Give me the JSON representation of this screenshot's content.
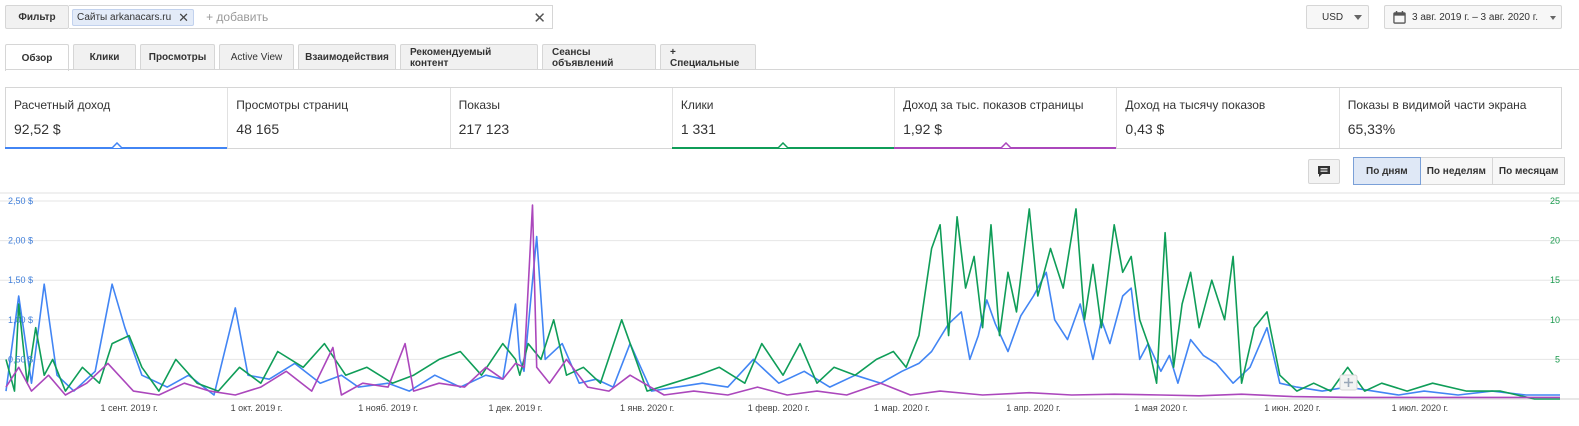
{
  "filter": {
    "label": "Фильтр",
    "chip_label": "Сайты",
    "chip_value": "arkanacars.ru",
    "add_placeholder": "+ добавить"
  },
  "currency": "USD",
  "date_range": "3 авг. 2019 г. – 3 авг. 2020 г.",
  "tabs": [
    {
      "label": "Обзор",
      "active": true
    },
    {
      "label": "Клики"
    },
    {
      "label": "Просмотры"
    },
    {
      "label": "Active View"
    },
    {
      "label": "Взаимодействия"
    },
    {
      "label": "Рекомендуемый контент"
    },
    {
      "label": "Сеансы объявлений"
    },
    {
      "label": "+ Специальные"
    }
  ],
  "scorecards": [
    {
      "label": "Расчетный доход",
      "value": "92,52 $",
      "color": "#4285f4"
    },
    {
      "label": "Просмотры страниц",
      "value": "48 165"
    },
    {
      "label": "Показы",
      "value": "217 123"
    },
    {
      "label": "Клики",
      "value": "1 331",
      "color": "#0f9d58"
    },
    {
      "label": "Доход за тыс. показов страницы",
      "value": "1,92 $",
      "color": "#ab47bc"
    },
    {
      "label": "Доход на тысячу показов",
      "value": "0,43 $"
    },
    {
      "label": "Показы в видимой части экрана",
      "value": "65,33%"
    }
  ],
  "granularity": [
    {
      "label": "По дням",
      "active": true
    },
    {
      "label": "По неделям"
    },
    {
      "label": "По месяцам"
    }
  ],
  "chart_data": {
    "type": "line",
    "grid": true,
    "y_left": {
      "ticks": [
        "0,50 $",
        "1,00 $",
        "1,50 $",
        "2,00 $",
        "2,50 $"
      ],
      "tick_values": [
        0.5,
        1.0,
        1.5,
        2.0,
        2.5
      ],
      "range": [
        0,
        2.5
      ]
    },
    "y_right": {
      "ticks": [
        "5",
        "10",
        "15",
        "20",
        "25"
      ],
      "tick_values": [
        5,
        10,
        15,
        20,
        25
      ],
      "range": [
        0,
        25
      ]
    },
    "x_ticks": [
      {
        "label": "1 сент. 2019 г.",
        "date": "2019-09-01"
      },
      {
        "label": "1 окт. 2019 г.",
        "date": "2019-10-01"
      },
      {
        "label": "1 нояб. 2019 г.",
        "date": "2019-11-01"
      },
      {
        "label": "1 дек. 2019 г.",
        "date": "2019-12-01"
      },
      {
        "label": "1 янв. 2020 г.",
        "date": "2020-01-01"
      },
      {
        "label": "1 февр. 2020 г.",
        "date": "2020-02-01"
      },
      {
        "label": "1 мар. 2020 г.",
        "date": "2020-03-01"
      },
      {
        "label": "1 апр. 2020 г.",
        "date": "2020-04-01"
      },
      {
        "label": "1 мая 2020 г.",
        "date": "2020-05-01"
      },
      {
        "label": "1 июн. 2020 г.",
        "date": "2020-06-01"
      },
      {
        "label": "1 июл. 2020 г.",
        "date": "2020-07-01"
      }
    ],
    "x_range": [
      "2019-08-03",
      "2020-08-03"
    ],
    "series": [
      {
        "color": "#4285f4",
        "axis": "left",
        "points": [
          [
            "2019-08-03",
            0.1
          ],
          [
            "2019-08-06",
            1.3
          ],
          [
            "2019-08-09",
            0.2
          ],
          [
            "2019-08-12",
            1.45
          ],
          [
            "2019-08-15",
            0.3
          ],
          [
            "2019-08-19",
            0.1
          ],
          [
            "2019-08-24",
            0.35
          ],
          [
            "2019-08-28",
            1.45
          ],
          [
            "2019-08-31",
            0.9
          ],
          [
            "2019-09-04",
            0.3
          ],
          [
            "2019-09-10",
            0.15
          ],
          [
            "2019-09-15",
            0.3
          ],
          [
            "2019-09-21",
            0.05
          ],
          [
            "2019-09-26",
            1.15
          ],
          [
            "2019-09-29",
            0.3
          ],
          [
            "2019-10-04",
            0.25
          ],
          [
            "2019-10-10",
            0.45
          ],
          [
            "2019-10-16",
            0.2
          ],
          [
            "2019-10-21",
            0.3
          ],
          [
            "2019-10-25",
            0.15
          ],
          [
            "2019-11-01",
            0.2
          ],
          [
            "2019-11-06",
            0.1
          ],
          [
            "2019-11-12",
            0.3
          ],
          [
            "2019-11-18",
            0.15
          ],
          [
            "2019-11-24",
            0.3
          ],
          [
            "2019-11-28",
            0.25
          ],
          [
            "2019-12-01",
            1.2
          ],
          [
            "2019-12-02",
            0.5
          ],
          [
            "2019-12-03",
            0.35
          ],
          [
            "2019-12-06",
            2.05
          ],
          [
            "2019-12-08",
            0.5
          ],
          [
            "2019-12-12",
            0.7
          ],
          [
            "2019-12-16",
            0.2
          ],
          [
            "2019-12-20",
            0.25
          ],
          [
            "2019-12-24",
            0.15
          ],
          [
            "2019-12-28",
            0.7
          ],
          [
            "2020-01-02",
            0.1
          ],
          [
            "2020-01-08",
            0.15
          ],
          [
            "2020-01-14",
            0.2
          ],
          [
            "2020-01-20",
            0.15
          ],
          [
            "2020-01-26",
            0.5
          ],
          [
            "2020-02-01",
            0.2
          ],
          [
            "2020-02-07",
            0.35
          ],
          [
            "2020-02-13",
            0.15
          ],
          [
            "2020-02-19",
            0.3
          ],
          [
            "2020-02-25",
            0.2
          ],
          [
            "2020-03-01",
            0.35
          ],
          [
            "2020-03-05",
            0.45
          ],
          [
            "2020-03-08",
            0.6
          ],
          [
            "2020-03-12",
            0.95
          ],
          [
            "2020-03-15",
            1.1
          ],
          [
            "2020-03-17",
            0.5
          ],
          [
            "2020-03-19",
            0.8
          ],
          [
            "2020-03-21",
            1.25
          ],
          [
            "2020-03-23",
            0.95
          ],
          [
            "2020-03-26",
            0.6
          ],
          [
            "2020-03-29",
            1.05
          ],
          [
            "2020-04-01",
            1.3
          ],
          [
            "2020-04-04",
            1.6
          ],
          [
            "2020-04-06",
            1.0
          ],
          [
            "2020-04-09",
            0.75
          ],
          [
            "2020-04-12",
            1.2
          ],
          [
            "2020-04-15",
            0.5
          ],
          [
            "2020-04-17",
            1.0
          ],
          [
            "2020-04-19",
            0.7
          ],
          [
            "2020-04-22",
            1.3
          ],
          [
            "2020-04-24",
            1.4
          ],
          [
            "2020-04-26",
            0.5
          ],
          [
            "2020-04-28",
            0.7
          ],
          [
            "2020-05-01",
            0.35
          ],
          [
            "2020-05-03",
            0.55
          ],
          [
            "2020-05-05",
            0.2
          ],
          [
            "2020-05-08",
            0.75
          ],
          [
            "2020-05-11",
            0.55
          ],
          [
            "2020-05-14",
            0.45
          ],
          [
            "2020-05-18",
            0.2
          ],
          [
            "2020-05-22",
            0.4
          ],
          [
            "2020-05-26",
            0.9
          ],
          [
            "2020-05-29",
            0.2
          ],
          [
            "2020-06-02",
            0.15
          ],
          [
            "2020-06-08",
            0.1
          ],
          [
            "2020-06-14",
            0.15
          ],
          [
            "2020-06-20",
            0.1
          ],
          [
            "2020-06-26",
            0.05
          ],
          [
            "2020-07-02",
            0.1
          ],
          [
            "2020-07-10",
            0.05
          ],
          [
            "2020-07-18",
            0.1
          ],
          [
            "2020-07-26",
            0.05
          ],
          [
            "2020-08-03",
            0.05
          ]
        ]
      },
      {
        "color": "#0f9d58",
        "axis": "right",
        "points": [
          [
            "2019-08-03",
            5
          ],
          [
            "2019-08-05",
            1
          ],
          [
            "2019-08-06",
            12
          ],
          [
            "2019-08-08",
            2
          ],
          [
            "2019-08-10",
            9
          ],
          [
            "2019-08-12",
            3
          ],
          [
            "2019-08-14",
            5
          ],
          [
            "2019-08-17",
            1
          ],
          [
            "2019-08-21",
            4
          ],
          [
            "2019-08-25",
            2
          ],
          [
            "2019-08-28",
            7
          ],
          [
            "2019-09-01",
            8
          ],
          [
            "2019-09-04",
            4
          ],
          [
            "2019-09-08",
            1
          ],
          [
            "2019-09-12",
            5
          ],
          [
            "2019-09-17",
            2
          ],
          [
            "2019-09-22",
            1
          ],
          [
            "2019-09-27",
            4
          ],
          [
            "2019-10-02",
            2
          ],
          [
            "2019-10-06",
            6
          ],
          [
            "2019-10-12",
            4
          ],
          [
            "2019-10-17",
            7
          ],
          [
            "2019-10-22",
            3
          ],
          [
            "2019-10-27",
            4
          ],
          [
            "2019-11-02",
            2
          ],
          [
            "2019-11-07",
            3
          ],
          [
            "2019-11-13",
            5
          ],
          [
            "2019-11-18",
            6
          ],
          [
            "2019-11-23",
            3
          ],
          [
            "2019-11-28",
            7
          ],
          [
            "2019-12-01",
            5
          ],
          [
            "2019-12-02",
            3
          ],
          [
            "2019-12-04",
            7
          ],
          [
            "2019-12-07",
            5
          ],
          [
            "2019-12-10",
            10
          ],
          [
            "2019-12-13",
            3
          ],
          [
            "2019-12-17",
            4
          ],
          [
            "2019-12-21",
            2
          ],
          [
            "2019-12-26",
            10
          ],
          [
            "2020-01-01",
            1
          ],
          [
            "2020-01-07",
            2
          ],
          [
            "2020-01-13",
            3
          ],
          [
            "2020-01-18",
            4
          ],
          [
            "2020-01-24",
            2
          ],
          [
            "2020-01-28",
            7
          ],
          [
            "2020-02-02",
            3
          ],
          [
            "2020-02-06",
            7
          ],
          [
            "2020-02-10",
            2
          ],
          [
            "2020-02-14",
            4
          ],
          [
            "2020-02-19",
            3
          ],
          [
            "2020-02-24",
            5
          ],
          [
            "2020-02-28",
            6
          ],
          [
            "2020-03-02",
            4
          ],
          [
            "2020-03-05",
            8
          ],
          [
            "2020-03-08",
            19
          ],
          [
            "2020-03-10",
            22
          ],
          [
            "2020-03-12",
            8
          ],
          [
            "2020-03-14",
            23
          ],
          [
            "2020-03-16",
            14
          ],
          [
            "2020-03-18",
            18
          ],
          [
            "2020-03-20",
            9
          ],
          [
            "2020-03-22",
            22
          ],
          [
            "2020-03-24",
            8
          ],
          [
            "2020-03-26",
            16
          ],
          [
            "2020-03-28",
            11
          ],
          [
            "2020-03-31",
            24
          ],
          [
            "2020-04-02",
            13
          ],
          [
            "2020-04-05",
            19
          ],
          [
            "2020-04-08",
            14
          ],
          [
            "2020-04-11",
            24
          ],
          [
            "2020-04-13",
            10
          ],
          [
            "2020-04-15",
            17
          ],
          [
            "2020-04-17",
            9
          ],
          [
            "2020-04-20",
            22
          ],
          [
            "2020-04-22",
            16
          ],
          [
            "2020-04-24",
            18
          ],
          [
            "2020-04-26",
            10
          ],
          [
            "2020-04-28",
            7
          ],
          [
            "2020-04-30",
            2
          ],
          [
            "2020-05-02",
            21
          ],
          [
            "2020-05-04",
            4
          ],
          [
            "2020-05-06",
            12
          ],
          [
            "2020-05-08",
            16
          ],
          [
            "2020-05-10",
            9
          ],
          [
            "2020-05-13",
            15
          ],
          [
            "2020-05-16",
            10
          ],
          [
            "2020-05-18",
            18
          ],
          [
            "2020-05-20",
            2
          ],
          [
            "2020-05-23",
            9
          ],
          [
            "2020-05-26",
            11
          ],
          [
            "2020-05-29",
            3
          ],
          [
            "2020-06-02",
            1
          ],
          [
            "2020-06-06",
            2
          ],
          [
            "2020-06-10",
            1
          ],
          [
            "2020-06-14",
            4
          ],
          [
            "2020-06-18",
            1
          ],
          [
            "2020-06-22",
            2
          ],
          [
            "2020-06-28",
            1
          ],
          [
            "2020-07-04",
            2
          ],
          [
            "2020-07-12",
            1
          ],
          [
            "2020-07-20",
            1
          ],
          [
            "2020-07-28",
            0
          ],
          [
            "2020-08-03",
            0
          ]
        ]
      },
      {
        "color": "#ab47bc",
        "axis": "left",
        "points": [
          [
            "2019-08-03",
            0.15
          ],
          [
            "2019-08-06",
            0.4
          ],
          [
            "2019-08-09",
            0.1
          ],
          [
            "2019-08-13",
            0.3
          ],
          [
            "2019-08-17",
            0.05
          ],
          [
            "2019-08-22",
            0.2
          ],
          [
            "2019-08-27",
            0.45
          ],
          [
            "2019-09-02",
            0.1
          ],
          [
            "2019-09-08",
            0.05
          ],
          [
            "2019-09-14",
            0.2
          ],
          [
            "2019-09-20",
            0.1
          ],
          [
            "2019-09-26",
            0.05
          ],
          [
            "2019-10-02",
            0.15
          ],
          [
            "2019-10-08",
            0.35
          ],
          [
            "2019-10-14",
            0.1
          ],
          [
            "2019-10-19",
            0.65
          ],
          [
            "2019-10-21",
            0.05
          ],
          [
            "2019-10-26",
            0.2
          ],
          [
            "2019-11-01",
            0.15
          ],
          [
            "2019-11-05",
            0.7
          ],
          [
            "2019-11-07",
            0.1
          ],
          [
            "2019-11-13",
            0.2
          ],
          [
            "2019-11-19",
            0.15
          ],
          [
            "2019-11-24",
            0.4
          ],
          [
            "2019-11-28",
            0.25
          ],
          [
            "2019-12-01",
            0.45
          ],
          [
            "2019-12-03",
            0.4
          ],
          [
            "2019-12-05",
            2.45
          ],
          [
            "2019-12-06",
            0.4
          ],
          [
            "2019-12-09",
            0.2
          ],
          [
            "2019-12-13",
            0.5
          ],
          [
            "2019-12-18",
            0.15
          ],
          [
            "2019-12-23",
            0.1
          ],
          [
            "2019-12-28",
            0.3
          ],
          [
            "2020-01-05",
            0.05
          ],
          [
            "2020-01-12",
            0.1
          ],
          [
            "2020-01-20",
            0.05
          ],
          [
            "2020-01-27",
            0.15
          ],
          [
            "2020-02-03",
            0.05
          ],
          [
            "2020-02-10",
            0.1
          ],
          [
            "2020-02-17",
            0.05
          ],
          [
            "2020-02-25",
            0.2
          ],
          [
            "2020-03-03",
            0.05
          ],
          [
            "2020-03-10",
            0.1
          ],
          [
            "2020-03-20",
            0.05
          ],
          [
            "2020-03-31",
            0.08
          ],
          [
            "2020-04-10",
            0.05
          ],
          [
            "2020-04-20",
            0.06
          ],
          [
            "2020-05-01",
            0.05
          ],
          [
            "2020-05-10",
            0.04
          ],
          [
            "2020-05-20",
            0.06
          ],
          [
            "2020-06-01",
            0.03
          ],
          [
            "2020-06-15",
            0.02
          ],
          [
            "2020-07-01",
            0.02
          ],
          [
            "2020-07-15",
            0.02
          ],
          [
            "2020-08-03",
            0.02
          ]
        ]
      }
    ]
  }
}
